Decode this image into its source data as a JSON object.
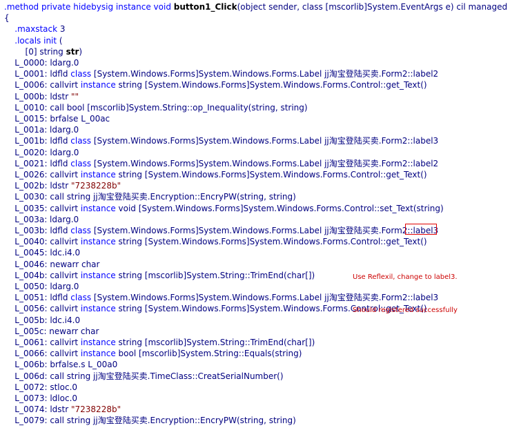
{
  "lines": [
    [
      [
        "kw",
        ".method private hidebysig instance void "
      ],
      [
        "bold",
        "button1_Click"
      ],
      [
        "plain",
        "(object sender, class [mscorlib]System.EventArgs e) cil managed"
      ]
    ],
    [
      [
        "plain",
        "{"
      ]
    ],
    [
      [
        "plain",
        "    "
      ],
      [
        "kw",
        ".maxstack"
      ],
      [
        "plain",
        " 3"
      ]
    ],
    [
      [
        "plain",
        "    "
      ],
      [
        "kw",
        ".locals init"
      ],
      [
        "plain",
        " ("
      ]
    ],
    [
      [
        "plain",
        "        [0] string "
      ],
      [
        "bold",
        "str"
      ],
      [
        "plain",
        ")"
      ]
    ],
    [
      [
        "plain",
        "    L_0000: ldarg.0"
      ]
    ],
    [
      [
        "plain",
        "    L_0001: ldfld "
      ],
      [
        "kw",
        "class"
      ],
      [
        "plain",
        " [System.Windows.Forms]System.Windows.Forms.Label jj淘宝登陆买卖.Form2::label2"
      ]
    ],
    [
      [
        "plain",
        "    L_0006: callvirt "
      ],
      [
        "kw",
        "instance"
      ],
      [
        "plain",
        " string [System.Windows.Forms]System.Windows.Forms.Control::get_Text()"
      ]
    ],
    [
      [
        "plain",
        "    L_000b: ldstr "
      ],
      [
        "str",
        "\"\""
      ]
    ],
    [
      [
        "plain",
        "    L_0010: call bool [mscorlib]System.String::op_Inequality(string, string)"
      ]
    ],
    [
      [
        "plain",
        "    L_0015: brfalse L_00ac"
      ]
    ],
    [
      [
        "plain",
        "    L_001a: ldarg.0"
      ]
    ],
    [
      [
        "plain",
        "    L_001b: ldfld "
      ],
      [
        "kw",
        "class"
      ],
      [
        "plain",
        " [System.Windows.Forms]System.Windows.Forms.Label jj淘宝登陆买卖.Form2::label3"
      ]
    ],
    [
      [
        "plain",
        "    L_0020: ldarg.0"
      ]
    ],
    [
      [
        "plain",
        "    L_0021: ldfld "
      ],
      [
        "kw",
        "class"
      ],
      [
        "plain",
        " [System.Windows.Forms]System.Windows.Forms.Label jj淘宝登陆买卖.Form2::label2"
      ]
    ],
    [
      [
        "plain",
        "    L_0026: callvirt "
      ],
      [
        "kw",
        "instance"
      ],
      [
        "plain",
        " string [System.Windows.Forms]System.Windows.Forms.Control::get_Text()"
      ]
    ],
    [
      [
        "plain",
        "    L_002b: ldstr "
      ],
      [
        "str",
        "\"7238228b\""
      ]
    ],
    [
      [
        "plain",
        "    L_0030: call string jj淘宝登陆买卖.Encryption::EncryPW(string, string)"
      ]
    ],
    [
      [
        "plain",
        "    L_0035: callvirt "
      ],
      [
        "kw",
        "instance"
      ],
      [
        "plain",
        " void [System.Windows.Forms]System.Windows.Forms.Control::set_Text(string)"
      ]
    ],
    [
      [
        "plain",
        "    L_003a: ldarg.0"
      ]
    ],
    [
      [
        "plain",
        "    L_003b: ldfld "
      ],
      [
        "kw",
        "class"
      ],
      [
        "plain",
        " [System.Windows.Forms]System.Windows.Forms.Label jj淘宝登陆买卖.Form2::label3"
      ]
    ],
    [
      [
        "plain",
        "    L_0040: callvirt "
      ],
      [
        "kw",
        "instance"
      ],
      [
        "plain",
        " string [System.Windows.Forms]System.Windows.Forms.Control::get_Text()"
      ]
    ],
    [
      [
        "plain",
        "    L_0045: ldc.i4.0"
      ]
    ],
    [
      [
        "plain",
        "    L_0046: newarr char"
      ]
    ],
    [
      [
        "plain",
        "    L_004b: callvirt "
      ],
      [
        "kw",
        "instance"
      ],
      [
        "plain",
        " string [mscorlib]System.String::TrimEnd(char[])"
      ]
    ],
    [
      [
        "plain",
        "    L_0050: ldarg.0"
      ]
    ],
    [
      [
        "plain",
        "    L_0051: ldfld "
      ],
      [
        "kw",
        "class"
      ],
      [
        "plain",
        " [System.Windows.Forms]System.Windows.Forms.Label jj淘宝登陆买卖.Form2::label3"
      ]
    ],
    [
      [
        "plain",
        "    L_0056: callvirt "
      ],
      [
        "kw",
        "instance"
      ],
      [
        "plain",
        " string [System.Windows.Forms]System.Windows.Forms.Control::get_Text()"
      ]
    ],
    [
      [
        "plain",
        "    L_005b: ldc.i4.0"
      ]
    ],
    [
      [
        "plain",
        "    L_005c: newarr char"
      ]
    ],
    [
      [
        "plain",
        "    L_0061: callvirt "
      ],
      [
        "kw",
        "instance"
      ],
      [
        "plain",
        " string [mscorlib]System.String::TrimEnd(char[])"
      ]
    ],
    [
      [
        "plain",
        "    L_0066: callvirt "
      ],
      [
        "kw",
        "instance"
      ],
      [
        "plain",
        " bool [mscorlib]System.String::Equals(string)"
      ]
    ],
    [
      [
        "plain",
        "    L_006b: brfalse.s L_00a0"
      ]
    ],
    [
      [
        "plain",
        "    L_006d: call string jj淘宝登陆买卖.TimeClass::CreatSerialNumber()"
      ]
    ],
    [
      [
        "plain",
        "    L_0072: stloc.0"
      ]
    ],
    [
      [
        "plain",
        "    L_0073: ldloc.0"
      ]
    ],
    [
      [
        "plain",
        "    L_0074: ldstr "
      ],
      [
        "str",
        "\"7238228b\""
      ]
    ],
    [
      [
        "plain",
        "    L_0079: call string jj淘宝登陆买卖.Encryption::EncryPW(string, string)"
      ]
    ]
  ],
  "annotation": {
    "line1": "Use Reflexil, change to label3.",
    "line2": "Should registered successfully"
  },
  "colors": {
    "keyword": "#0000ff",
    "text": "#000080",
    "string": "#800000",
    "annotation": "#cc0000",
    "highlight_border": "#e00000"
  }
}
